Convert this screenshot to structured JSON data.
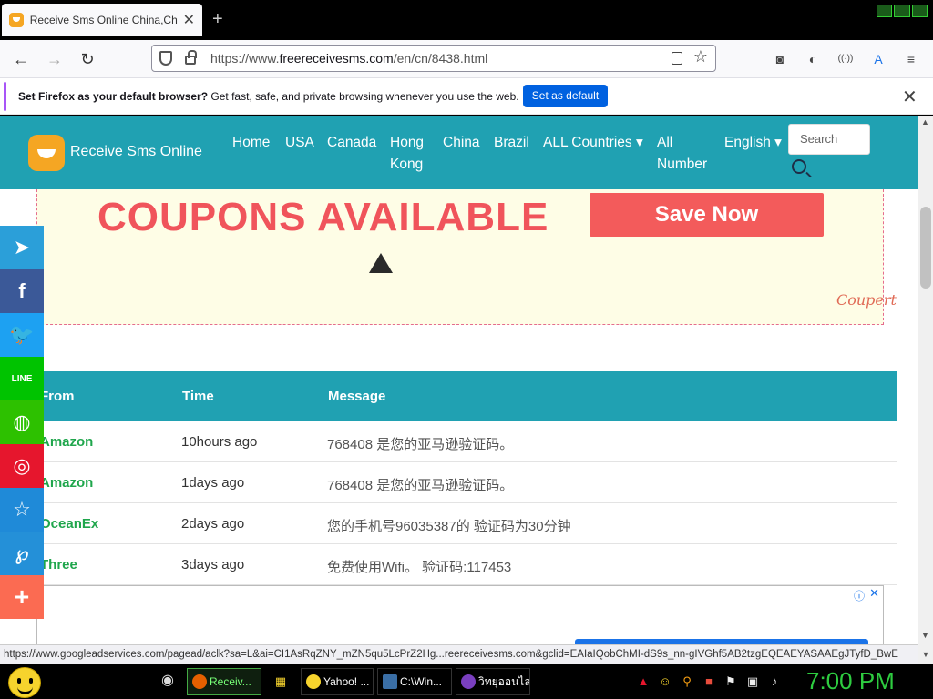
{
  "browser": {
    "tab_title": "Receive Sms Online China,Chin",
    "tab_close": "✕",
    "new_tab": "+",
    "url_prefix": "https://www.",
    "url_domain": "freereceivesms.com",
    "url_path": "/en/cn/8438.html"
  },
  "notification": {
    "bold_text": "Set Firefox as your default browser?",
    "text": " Get fast, safe, and private browsing whenever you use the web.",
    "button": "Set as default",
    "close": "✕"
  },
  "site": {
    "brand": "Receive Sms Online",
    "nav": [
      "Home",
      "USA",
      "Canada",
      "Hong",
      "Kong",
      "China",
      "Brazil",
      "ALL Countries ▾",
      "All",
      "Number",
      "English ▾"
    ],
    "search_placeholder": "Search"
  },
  "ad": {
    "headline": "COUPONS AVAILABLE",
    "button": "Save Now",
    "brand": "Coupert"
  },
  "table": {
    "headers": [
      "From",
      "Time",
      "Message"
    ],
    "rows": [
      {
        "from": "Amazon",
        "time": "10hours ago",
        "message": "768408 是您的亚马逊验证码。"
      },
      {
        "from": "Amazon",
        "time": "1days ago",
        "message": "768408 是您的亚马逊验证码。"
      },
      {
        "from": "OceanEx",
        "time": "2days ago",
        "message": "您的手机号96035387的 验证码为30分钟"
      },
      {
        "from": "Three",
        "time": "3days ago",
        "message": "免费使用Wifi。 验证码:117453"
      }
    ]
  },
  "social_icons": [
    "telegram-icon",
    "facebook-icon",
    "twitter-icon",
    "line-icon",
    "wechat-icon",
    "weibo-icon",
    "star-icon",
    "pinterest-icon",
    "plus-icon"
  ],
  "social_colors": [
    "#2b9fd9",
    "#3b5998",
    "#1da1f2",
    "#00c300",
    "#2dc100",
    "#e6162d",
    "#1f8ad8",
    "#2490d8",
    "#fb6b52"
  ],
  "ad2": {
    "info": "ⓘ",
    "close": "✕"
  },
  "status_url": "https://www.googleadservices.com/pagead/aclk?sa=L&ai=CI1AsRqZNY_mZN5qu5LcPrZ2Hg...reereceivesms.com&gclid=EAIaIQobChMI-dS9s_nn-gIVGhf5AB2tzgEQEAEYASAAEgJTyfD_BwE",
  "taskbar": {
    "tasks": [
      "Receiv...",
      "Yahoo! ...",
      "C:\\Win...",
      "วิทยุออนไลน์ - ..."
    ],
    "clock": "7:00 PM"
  }
}
